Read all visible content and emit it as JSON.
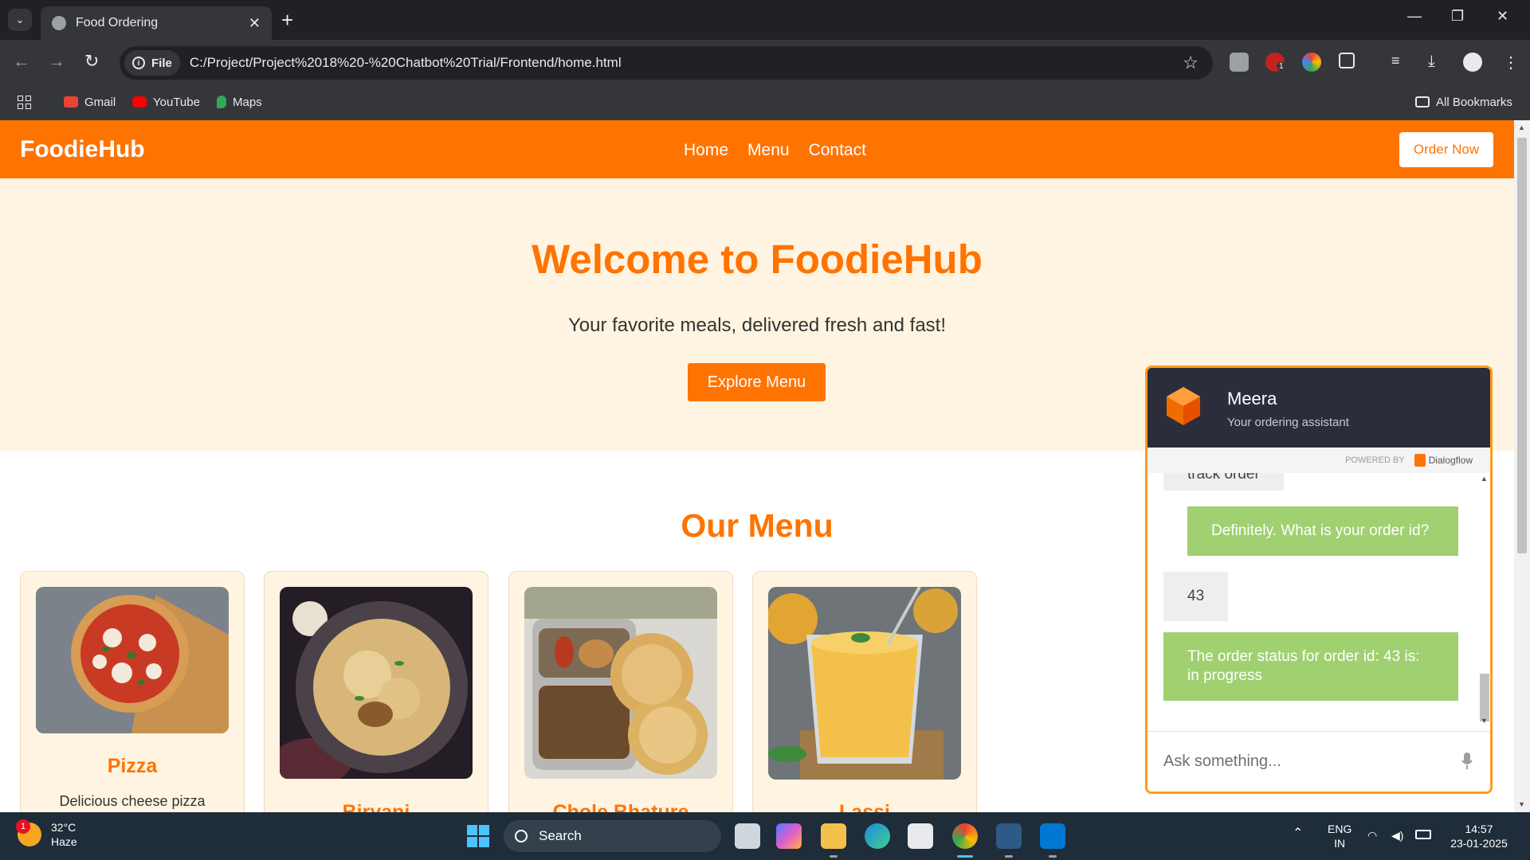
{
  "browser": {
    "tab_title": "Food Ordering",
    "new_tab": "+",
    "window_controls": [
      "—",
      "❐",
      "✕"
    ],
    "site_chip": "File",
    "url": "C:/Project/Project%2018%20-%20Chatbot%20Trial/Frontend/home.html",
    "extension_badge": "1",
    "bookmarks": [
      "Gmail",
      "YouTube",
      "Maps"
    ],
    "all_bookmarks": "All Bookmarks"
  },
  "site": {
    "logo": "FoodieHub",
    "nav": [
      "Home",
      "Menu",
      "Contact"
    ],
    "order_now": "Order Now",
    "hero_title": "Welcome to FoodieHub",
    "hero_subtitle": "Your favorite meals, delivered fresh and fast!",
    "explore_button": "Explore Menu",
    "menu_title": "Our Menu",
    "menu_items": [
      {
        "name": "Pizza",
        "desc": "Delicious cheese pizza"
      },
      {
        "name": "Biryani",
        "desc": ""
      },
      {
        "name": "Chole Bhature",
        "desc": ""
      },
      {
        "name": "Lassi",
        "desc": ""
      }
    ]
  },
  "chat": {
    "agent_name": "Meera",
    "agent_subtitle": "Your ordering assistant",
    "powered_by": "POWERED BY",
    "powered_brand": "Dialogflow",
    "messages": [
      {
        "from": "user",
        "text": "track order"
      },
      {
        "from": "bot",
        "text": "Definitely. What is your order id?"
      },
      {
        "from": "user",
        "text": "43"
      },
      {
        "from": "bot",
        "text": "The order status for order id: 43 is: in progress"
      }
    ],
    "input_placeholder": "Ask something..."
  },
  "taskbar": {
    "weather_badge": "1",
    "temperature": "32°C",
    "condition": "Haze",
    "search_label": "Search",
    "lang_line1": "ENG",
    "lang_line2": "IN",
    "time": "14:57",
    "date": "23-01-2025"
  },
  "colors": {
    "brand_orange": "#ff7300",
    "hero_bg": "#fff4e1",
    "bot_bubble": "#a0d070",
    "chat_header": "#2b2d3a"
  }
}
